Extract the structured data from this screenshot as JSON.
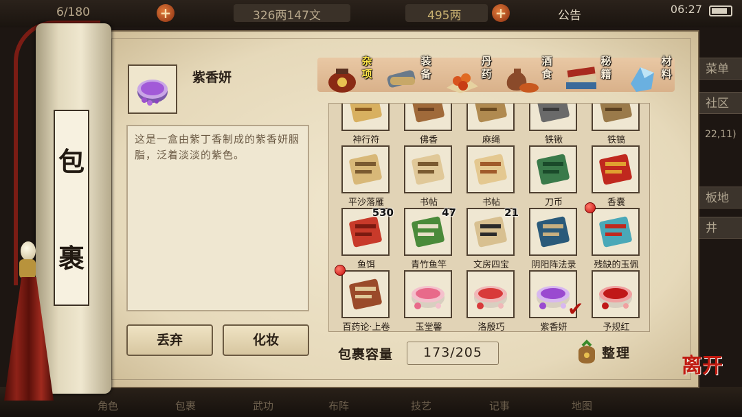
{
  "hud": {
    "count": "6/180",
    "money": "326两147文",
    "gold": "495两",
    "notice": "公告",
    "time": "06:27"
  },
  "side_menu": {
    "menu": "菜单",
    "community": "社区",
    "coords": "22,11)",
    "board": "板地",
    "well": "井"
  },
  "bottom_menu": [
    "角色",
    "包裹",
    "武功",
    "布阵",
    "技艺",
    "记事",
    "地图"
  ],
  "roll": {
    "title_top": "包",
    "title_bottom": "裹"
  },
  "detail": {
    "name": "紫香妍",
    "description": "这是一盒由紫丁香制成的紫香妍胭脂，泛着淡淡的紫色。",
    "discard": "丢弃",
    "makeup": "化妆"
  },
  "tabs": [
    {
      "label": "杂项",
      "icon": "jar-icon",
      "active": true
    },
    {
      "label": "装备",
      "icon": "scroll-bundle-icon",
      "active": false
    },
    {
      "label": "丹药",
      "icon": "pills-icon",
      "active": false
    },
    {
      "label": "酒食",
      "icon": "wine-food-icon",
      "active": false
    },
    {
      "label": "秘籍",
      "icon": "books-icon",
      "active": false
    },
    {
      "label": "材料",
      "icon": "crystal-icon",
      "active": false
    }
  ],
  "items": [
    {
      "name": "神行符",
      "icon": "talisman-icon"
    },
    {
      "name": "佛香",
      "icon": "incense-icon"
    },
    {
      "name": "麻绳",
      "icon": "rope-icon"
    },
    {
      "name": "铁锹",
      "icon": "shovel-icon"
    },
    {
      "name": "铁镐",
      "icon": "pickaxe-icon"
    },
    {
      "name": "平沙落雁",
      "icon": "music-book-icon"
    },
    {
      "name": "书帖",
      "icon": "calligraphy-scroll-icon"
    },
    {
      "name": "书帖",
      "icon": "calligraphy-sheet-icon"
    },
    {
      "name": "刀币",
      "icon": "knife-coin-icon"
    },
    {
      "name": "香囊",
      "icon": "sachet-icon"
    },
    {
      "name": "鱼饵",
      "icon": "worm-icon",
      "count": "530"
    },
    {
      "name": "青竹鱼竿",
      "icon": "fishing-rod-icon",
      "count": "47"
    },
    {
      "name": "文房四宝",
      "icon": "writing-set-icon",
      "count": "21"
    },
    {
      "name": "阴阳阵法录",
      "icon": "manual-book-icon"
    },
    {
      "name": "残缺的玉佩",
      "icon": "jade-pendant-icon",
      "dot": true
    },
    {
      "name": "百药论·上卷",
      "icon": "medicine-book-icon",
      "dot": true
    },
    {
      "name": "玉堂馨",
      "icon": "rouge-pink-icon"
    },
    {
      "name": "洛殷巧",
      "icon": "rouge-red-icon"
    },
    {
      "name": "紫香妍",
      "icon": "rouge-purple-icon",
      "selected": true
    },
    {
      "name": "予规红",
      "icon": "rouge-crimson-icon"
    }
  ],
  "capacity": {
    "label": "包裹容量",
    "value": "173/205",
    "used": 173,
    "total": 205
  },
  "sort": {
    "label": "整理"
  },
  "leave": "离开",
  "colors": {
    "selected_tab": "#ffe64a",
    "red_dot": "#c30e0e",
    "leave": "#c01a10"
  }
}
